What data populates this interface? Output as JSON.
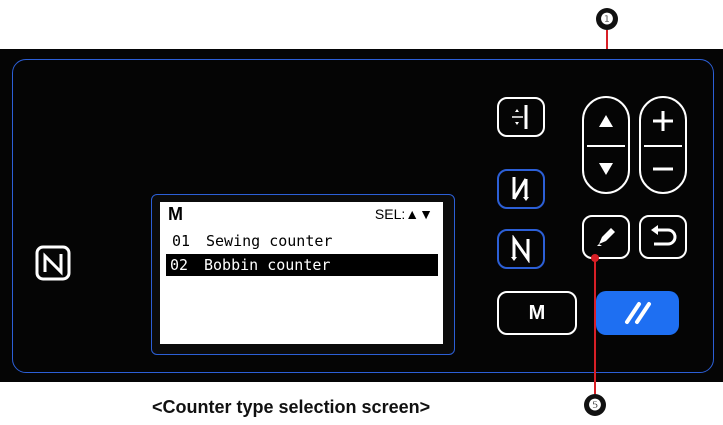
{
  "lcd": {
    "title": "M",
    "sel_label": "SEL:▲▼",
    "items": [
      {
        "num": "01",
        "label": "Sewing counter",
        "selected": false
      },
      {
        "num": "02",
        "label": "Bobbin counter",
        "selected": true
      }
    ]
  },
  "buttons": {
    "m_label": "M",
    "up_icon": "up-arrow-icon",
    "down_icon": "down-arrow-icon",
    "plus_icon": "plus-icon",
    "minus_icon": "minus-icon",
    "edit_icon": "pencil-icon",
    "return_icon": "return-icon",
    "ready_icon": "ready-icon"
  },
  "markers": {
    "marker_1": "❶",
    "marker_5": "❺"
  },
  "caption": "<Counter type selection screen>",
  "colors": {
    "accent_blue": "#2c5fd6",
    "ready_blue": "#1e6ff2",
    "leader_red": "#d81f26"
  }
}
